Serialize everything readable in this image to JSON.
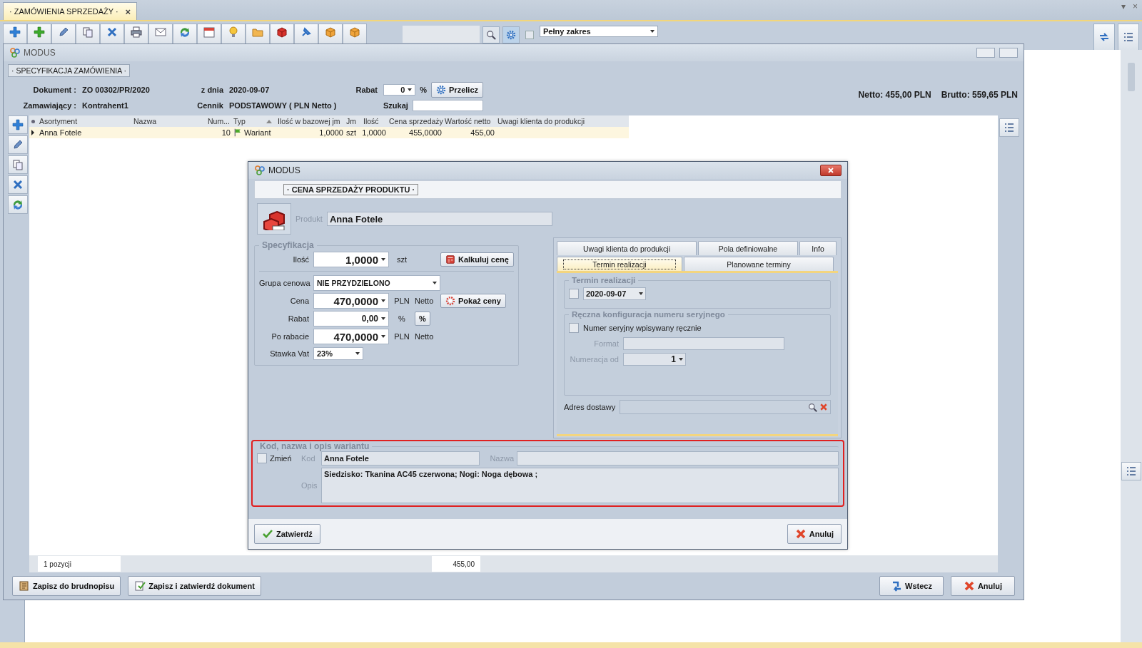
{
  "app_tab": {
    "label": "· ZAMÓWIENIA SPRZEDAŻY ·",
    "close": "×",
    "selected": true
  },
  "window_controls": {
    "menu": "▾",
    "close": "×"
  },
  "toolbar": {
    "range": "Pełny zakres"
  },
  "main_window": {
    "title": "MODUS",
    "section": "· SPECYFIKACJA ZAMÓWIENIA ·",
    "header": {
      "document_label": "Dokument :",
      "document": "ZO 00302/PR/2020",
      "date_label": "z dnia",
      "date": "2020-09-07",
      "discount_label": "Rabat",
      "discount": "0",
      "percent": "%",
      "recalc_button": "Przelicz",
      "customer_label": "Zamawiający :",
      "customer": "Kontrahent1",
      "pricelist_label": "Cennik",
      "pricelist": "PODSTAWOWY ( PLN Netto )",
      "search_label": "Szukaj",
      "netto": "Netto: 455,00 PLN",
      "brutto": "Brutto: 559,65 PLN"
    },
    "grid": {
      "columns": [
        "Asortyment",
        "Nazwa",
        "Num...",
        "Typ",
        "Ilość w bazowej jm",
        "Jm",
        "Ilość",
        "Cena sprzedaży",
        "Wartość netto",
        "Uwagi klienta do produkcji"
      ],
      "rows": [
        {
          "selected": true,
          "cells": [
            "Anna Fotele",
            null,
            "10",
            "Wariant",
            "1,0000",
            "szt",
            "1,0000",
            "455,0000",
            "455,00",
            null
          ]
        }
      ]
    },
    "footer": {
      "count": "1 pozycji",
      "sum": "455,00"
    },
    "left_buttons": [
      "Zapisz do brudnopisu",
      "Zapisz i zatwierdź dokument"
    ],
    "right_buttons": [
      "Wstecz",
      "Anuluj"
    ]
  },
  "dialog": {
    "title": "MODUS",
    "section": "· CENA SPRZEDAŻY PRODUKTU ·",
    "product_label": "Produkt",
    "product": "Anna Fotele",
    "spec": {
      "legend": "Specyfikacja",
      "qty_label": "Ilość",
      "qty": "1,0000",
      "qty_unit": "szt",
      "calc_button": "Kalkuluj cenę",
      "group_label": "Grupa cenowa",
      "group": "NIE PRZYDZIELONO",
      "price_label": "Cena",
      "price": "470,0000",
      "price_currency": "PLN",
      "price_type": "Netto",
      "show_prices_button": "Pokaż ceny",
      "discount_label": "Rabat",
      "discount": "0,00",
      "discount_unit": "%",
      "percent_button": "%",
      "after_label": "Po rabacie",
      "after": "470,0000",
      "after_currency": "PLN",
      "after_type": "Netto",
      "vat_label": "Stawka Vat",
      "vat": "23%"
    },
    "tabs_row1": [
      {
        "label": "Uwagi klienta do produkcji",
        "selected": false
      },
      {
        "label": "Pola definiowalne",
        "selected": false
      },
      {
        "label": "Info",
        "selected": false
      }
    ],
    "tabs_row2": [
      {
        "label": "Termin realizacji",
        "selected": true
      },
      {
        "label": "Planowane terminy",
        "selected": false
      }
    ],
    "realization": {
      "legend": "Termin realizacji",
      "checked": false,
      "date": "2020-09-07"
    },
    "serial": {
      "legend": "Ręczna konfiguracja numeru seryjnego",
      "checkbox_label": "Numer seryjny wpisywany ręcznie",
      "checked": false,
      "format_label": "Format",
      "start_label": "Numeracja od",
      "start": "1"
    },
    "address_label": "Adres dostawy",
    "variant": {
      "legend": "Kod, nazwa i opis wariantu",
      "highlighted": true,
      "change_label": "Zmień",
      "checked": false,
      "code_label": "Kod",
      "code": "Anna Fotele",
      "name_label": "Nazwa",
      "desc_label": "Opis",
      "desc": "Siedzisko: Tkanina AC45 czerwona; Nogi: Noga dębowa ;"
    },
    "confirm_button": "Zatwierdź",
    "cancel_button": "Anuluj"
  }
}
